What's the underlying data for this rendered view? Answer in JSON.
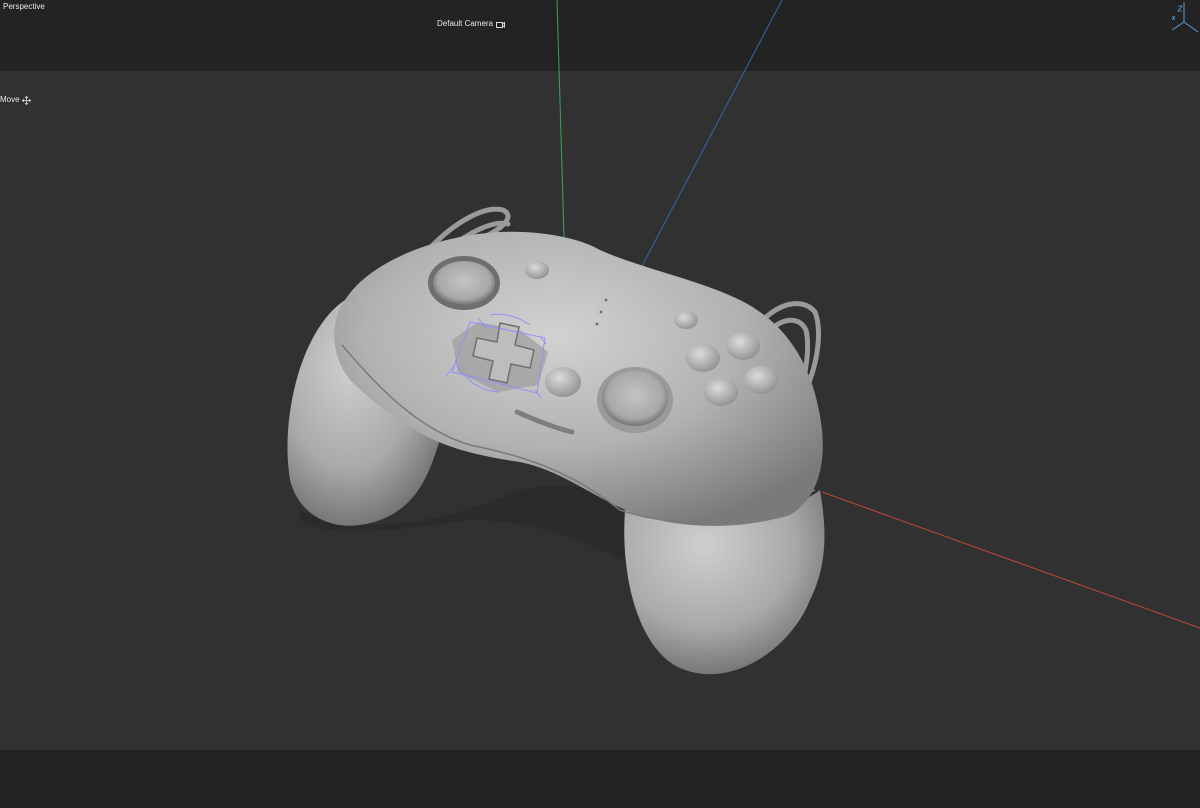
{
  "viewport": {
    "view_name": "Perspective",
    "camera_name": "Default Camera",
    "camera_icon": "camera-icon",
    "active_tool": "Move",
    "tool_icon": "move-icon",
    "gizmo_icon": "axis-gizmo-icon"
  },
  "colors": {
    "background": "#313131",
    "band": "#232323",
    "axis_x": "#c0463a",
    "axis_y": "#3aa35a",
    "axis_z": "#3466b4",
    "model": "#b4b4b4",
    "selection": "#8c8cff"
  },
  "scene": {
    "object": "gamepad-model",
    "selected_part": "dpad"
  }
}
